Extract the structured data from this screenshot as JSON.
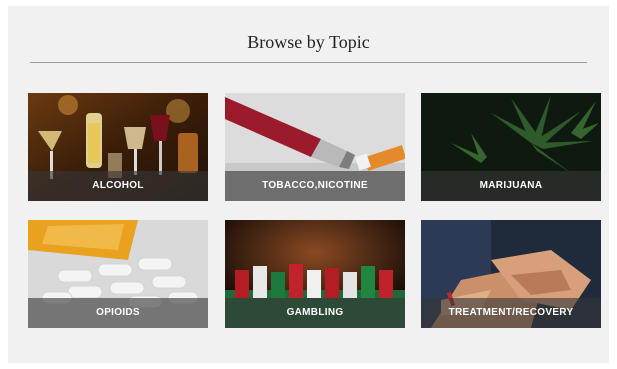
{
  "page": {
    "title": "Browse by Topic"
  },
  "topics": [
    {
      "label": "ALCOHOL"
    },
    {
      "label": "TOBACCO,NICOTINE"
    },
    {
      "label": "MARIJUANA"
    },
    {
      "label": "OPIOIDS"
    },
    {
      "label": "GAMBLING"
    },
    {
      "label": "TREATMENT/RECOVERY"
    }
  ],
  "colors": {
    "panel_background": "#f1f1f1",
    "caption_overlay": "#373737",
    "caption_text": "#ffffff",
    "title_text": "#222222"
  }
}
